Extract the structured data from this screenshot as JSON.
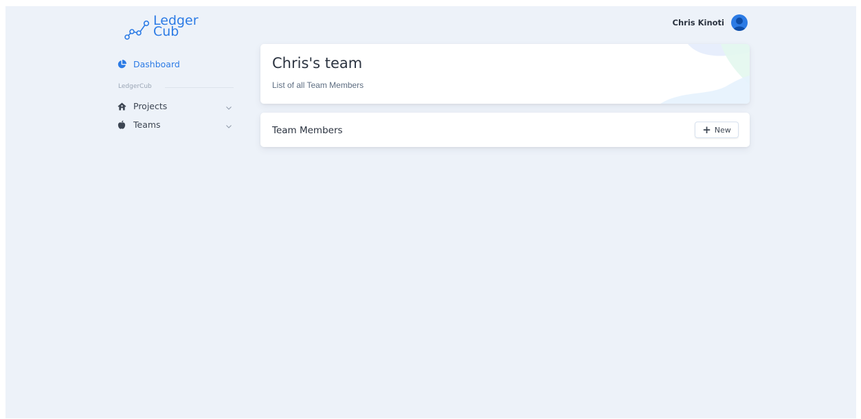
{
  "logo": {
    "line1": "Ledger",
    "line2": "Cub"
  },
  "user": {
    "name": "Chris Kinoti"
  },
  "sidebar": {
    "dashboard_label": "Dashboard",
    "section_label": "LedgerCub",
    "items": [
      {
        "label": "Projects",
        "icon": "home-icon"
      },
      {
        "label": "Teams",
        "icon": "apple-icon"
      }
    ]
  },
  "team_card": {
    "title": "Chris's team",
    "subtitle": "List of all Team Members"
  },
  "members_card": {
    "title": "Team Members",
    "new_button_label": "New"
  },
  "colors": {
    "accent": "#2c7be5",
    "background": "#edf2f9"
  }
}
